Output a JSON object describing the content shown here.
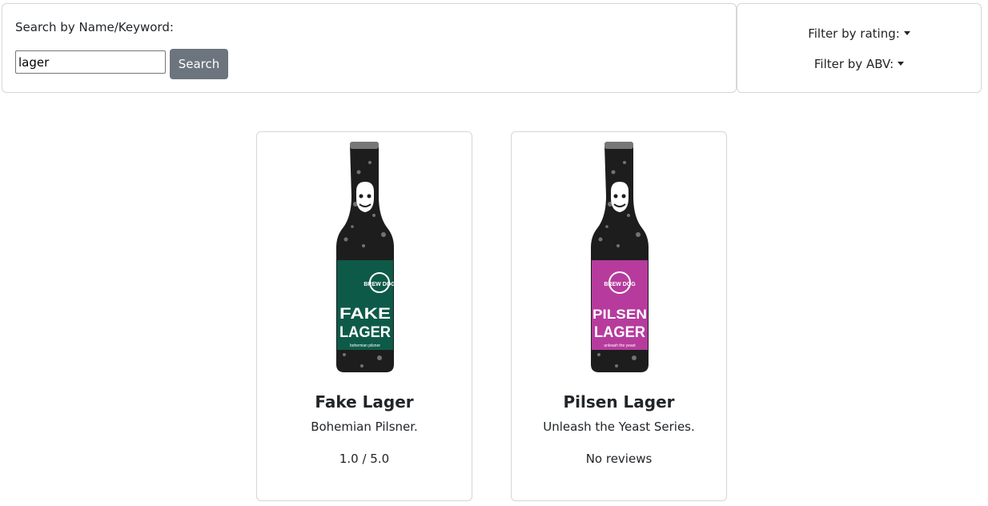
{
  "search": {
    "label": "Search by Name/Keyword:",
    "value": "lager",
    "button_label": "Search"
  },
  "filters": {
    "rating_label": "Filter by rating:",
    "abv_label": "Filter by ABV:"
  },
  "beers": [
    {
      "name": "Fake Lager",
      "description": "Bohemian Pilsner.",
      "rating": "1.0 / 5.0",
      "label_color": "#0e5a48",
      "label_text": [
        "FAKE",
        "LAGER"
      ],
      "brand": "BREW DOG",
      "small_text": "bohemian pilsner",
      "icon": "beer-bottle-image"
    },
    {
      "name": "Pilsen Lager",
      "description": "Unleash the Yeast Series.",
      "rating": "No reviews",
      "label_color": "#b63b9d",
      "label_text": [
        "PILSEN",
        "LAGER"
      ],
      "brand": "BREW DOG",
      "small_text": "unleash the yeast",
      "icon": "beer-bottle-image"
    }
  ]
}
